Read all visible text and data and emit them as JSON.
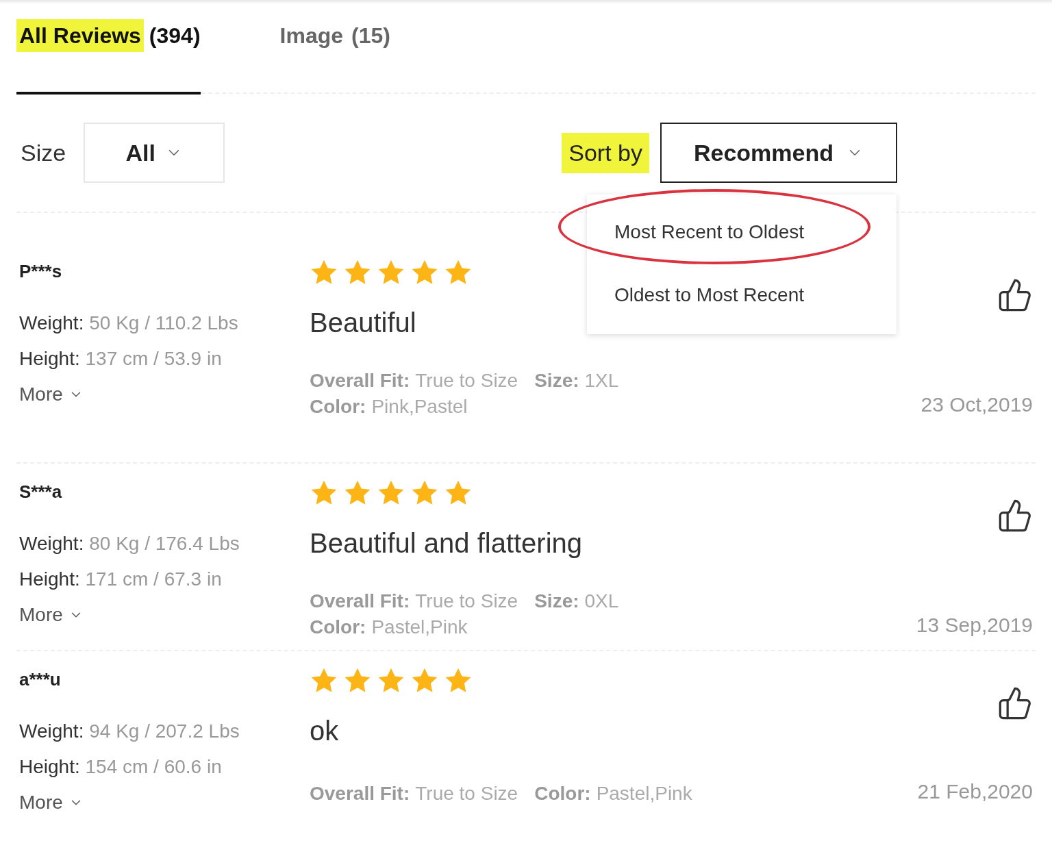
{
  "tabs": [
    {
      "label": "All Reviews",
      "count": "(394)",
      "selected": true,
      "highlighted": true
    },
    {
      "label": "Image",
      "count": "(15)",
      "selected": false,
      "highlighted": false
    }
  ],
  "filters": {
    "size_label": "Size",
    "size_value": "All",
    "sort_label": "Sort by",
    "sort_label_highlighted": true,
    "sort_value": "Recommend"
  },
  "sort_menu": {
    "open": true,
    "items": [
      {
        "label": "Most Recent to Oldest",
        "circled": true
      },
      {
        "label": "Oldest to Most Recent",
        "circled": false
      }
    ]
  },
  "reviews": [
    {
      "name": "P***s",
      "weight_label": "Weight:",
      "weight": "50 Kg / 110.2 Lbs",
      "height_label": "Height:",
      "height": "137 cm / 53.9 in",
      "more": "More",
      "stars": 5,
      "title": "Beautiful",
      "details": [
        {
          "label": "Overall Fit:",
          "value": "True to Size"
        },
        {
          "label": "Size:",
          "value": "1XL"
        },
        {
          "label": "Color:",
          "value": "Pink,Pastel"
        }
      ],
      "date": "23 Oct,2019"
    },
    {
      "name": "S***a",
      "weight_label": "Weight:",
      "weight": "80 Kg / 176.4 Lbs",
      "height_label": "Height:",
      "height": "171 cm / 67.3 in",
      "more": "More",
      "stars": 5,
      "title": "Beautiful and flattering",
      "details": [
        {
          "label": "Overall Fit:",
          "value": "True to Size"
        },
        {
          "label": "Size:",
          "value": "0XL"
        },
        {
          "label": "Color:",
          "value": "Pastel,Pink"
        }
      ],
      "date": "13 Sep,2019"
    },
    {
      "name": "a***u",
      "weight_label": "Weight:",
      "weight": "94 Kg / 207.2 Lbs",
      "height_label": "Height:",
      "height": "154 cm / 60.6 in",
      "more": "More",
      "stars": 5,
      "title": "ok",
      "details": [
        {
          "label": "Overall Fit:",
          "value": "True to Size"
        },
        {
          "label": "Color:",
          "value": "Pastel,Pink"
        }
      ],
      "date": "21 Feb,2020"
    }
  ]
}
